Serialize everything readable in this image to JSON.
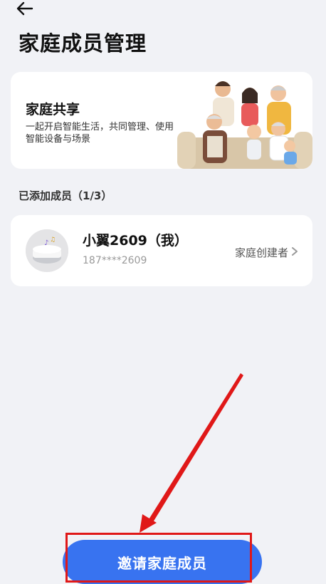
{
  "header": {
    "back_icon": "arrow-left-icon",
    "title": "家庭成员管理"
  },
  "share_card": {
    "title": "家庭共享",
    "description": "一起开启智能生活，共同管理、使用智能设备与场景",
    "illustration": "family-illustration"
  },
  "members_section": {
    "label": "已添加成员（1/3）"
  },
  "members": [
    {
      "name": "小翼2609（我）",
      "phone": "187****2609",
      "role": "家庭创建者",
      "avatar_icon": "smart-speaker-avatar"
    }
  ],
  "invite_button": {
    "label": "邀请家庭成员"
  },
  "colors": {
    "accent": "#3873f0",
    "annotation": "#e01818",
    "background": "#f1f2f6"
  }
}
